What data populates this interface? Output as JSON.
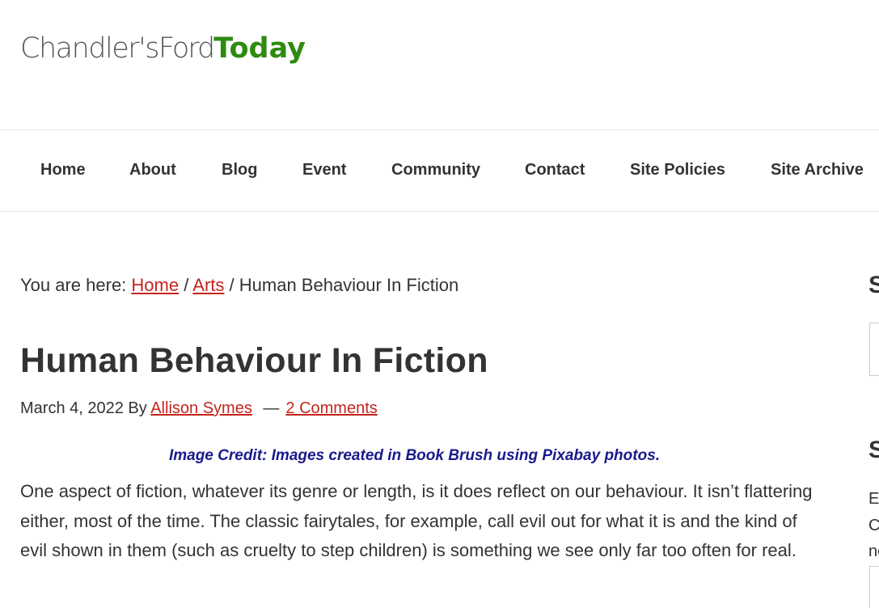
{
  "logo": {
    "part1": "Chandler's",
    "part2": "Ford",
    "part3": "Today"
  },
  "nav": {
    "items": [
      {
        "label": "Home"
      },
      {
        "label": "About"
      },
      {
        "label": "Blog"
      },
      {
        "label": "Event"
      },
      {
        "label": "Community"
      },
      {
        "label": "Contact"
      },
      {
        "label": "Site Policies"
      },
      {
        "label": "Site Archive"
      }
    ]
  },
  "breadcrumb": {
    "prefix": "You are here:",
    "home": "Home",
    "category": "Arts",
    "separator": "/",
    "current": "Human Behaviour In Fiction"
  },
  "post": {
    "title": "Human Behaviour In Fiction",
    "date": "March 4, 2022",
    "by": "By",
    "author": "Allison Symes",
    "dash": "—",
    "comments": "2 Comments",
    "image_credit": "Image Credit:  Images created in Book Brush using Pixabay photos.",
    "paragraph": "One aspect of fiction, whatever its genre or length, is it does reflect on our behaviour. It isn’t flattering either, most of the time. The classic fairytales, for example, call evil out for what it is and the kind of evil shown in them (such as cruelty to step children) is something we see only far too often for real."
  },
  "sidebar": {
    "heading1": "S",
    "heading2": "S",
    "text_line1": "E",
    "text_line2": "C",
    "text_line3": "ne"
  },
  "colors": {
    "link": "#c3251d",
    "logo_green": "#2e8b10",
    "credit_blue": "#1a1a8c",
    "text": "#333333"
  }
}
